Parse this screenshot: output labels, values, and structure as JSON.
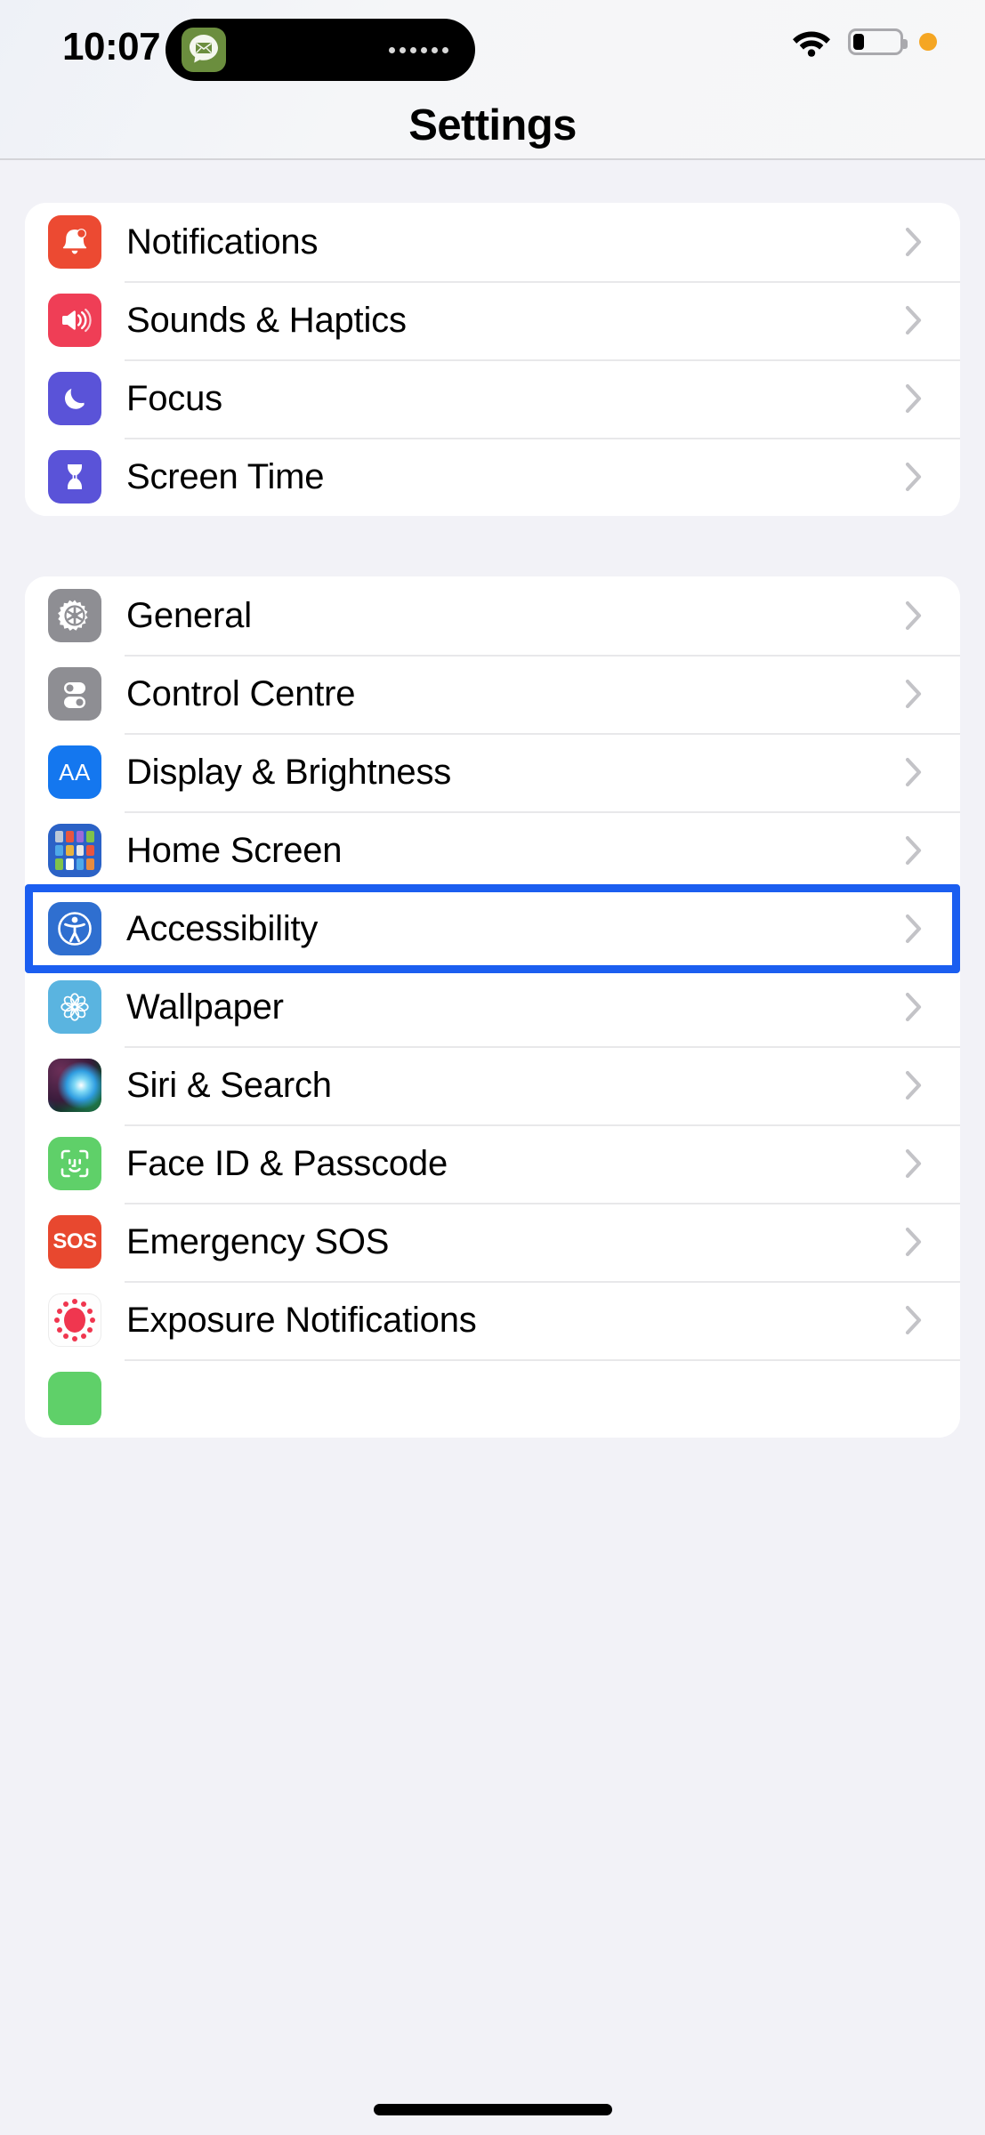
{
  "status_bar": {
    "time": "10:07",
    "dynamic_island_app_icon": "mail-bubble-icon",
    "dynamic_island_dots": "......",
    "wifi_icon": "wifi-icon",
    "battery_icon": "battery-low-icon",
    "battery_level_percent": 20,
    "privacy_indicator": "orange-privacy-dot",
    "privacy_indicator_color": "#f5a623"
  },
  "nav": {
    "title": "Settings"
  },
  "groups": [
    {
      "id": "group-1",
      "rows": [
        {
          "label": "Notifications",
          "icon": "bell-icon",
          "icon_color": "#ec4a32",
          "chevron": "chevron-right-icon"
        },
        {
          "label": "Sounds & Haptics",
          "icon": "speaker-waves-icon",
          "icon_color": "#ef3e56",
          "chevron": "chevron-right-icon"
        },
        {
          "label": "Focus",
          "icon": "moon-icon",
          "icon_color": "#5a53d8",
          "chevron": "chevron-right-icon"
        },
        {
          "label": "Screen Time",
          "icon": "hourglass-icon",
          "icon_color": "#5a53d8",
          "chevron": "chevron-right-icon"
        }
      ]
    },
    {
      "id": "group-2",
      "rows": [
        {
          "label": "General",
          "icon": "gear-icon",
          "icon_color": "#8e8e93",
          "chevron": "chevron-right-icon"
        },
        {
          "label": "Control Centre",
          "icon": "toggles-icon",
          "icon_color": "#8e8e93",
          "chevron": "chevron-right-icon"
        },
        {
          "label": "Display & Brightness",
          "icon": "aa-text-icon",
          "icon_color": "#1477ef",
          "chevron": "chevron-right-icon"
        },
        {
          "label": "Home Screen",
          "icon": "app-grid-icon",
          "icon_color": "#2b62c6",
          "chevron": "chevron-right-icon"
        },
        {
          "label": "Accessibility",
          "icon": "accessibility-icon",
          "icon_color": "#2f6fd0",
          "chevron": "chevron-right-icon"
        },
        {
          "label": "Wallpaper",
          "icon": "flower-icon",
          "icon_color": "#5ab4e0",
          "chevron": "chevron-right-icon"
        },
        {
          "label": "Siri & Search",
          "icon": "siri-orb-icon",
          "icon_color": "#120e18",
          "chevron": "chevron-right-icon"
        },
        {
          "label": "Face ID & Passcode",
          "icon": "face-id-icon",
          "icon_color": "#5fd069",
          "chevron": "chevron-right-icon"
        },
        {
          "label": "Emergency SOS",
          "icon": "sos-icon",
          "icon_color": "#e8482f",
          "chevron": "chevron-right-icon"
        },
        {
          "label": "Exposure Notifications",
          "icon": "exposure-dots-icon",
          "icon_color": "#f0364f",
          "chevron": "chevron-right-icon"
        }
      ]
    }
  ],
  "highlight": {
    "target_row_label": "Accessibility",
    "color": "#1b5ef0"
  },
  "home_indicator": "home-indicator-bar"
}
